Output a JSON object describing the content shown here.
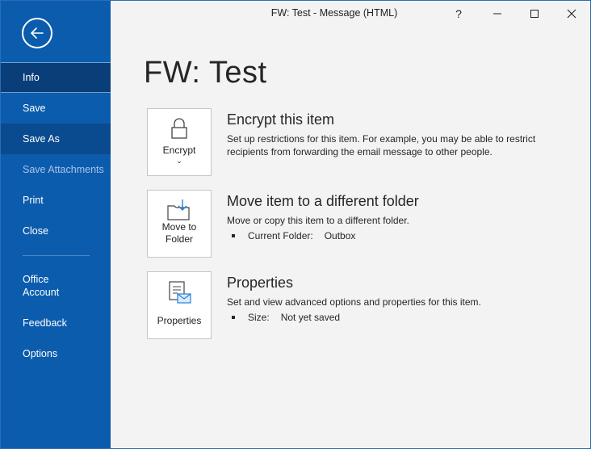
{
  "window": {
    "title": "FW: Test  -  Message (HTML)",
    "help": "?"
  },
  "sidebar": {
    "items": [
      {
        "label": "Info"
      },
      {
        "label": "Save"
      },
      {
        "label": "Save As"
      },
      {
        "label": "Save Attachments"
      },
      {
        "label": "Print"
      },
      {
        "label": "Close"
      },
      {
        "label": "Office\nAccount"
      },
      {
        "label": "Feedback"
      },
      {
        "label": "Options"
      }
    ]
  },
  "main": {
    "title": "FW: Test",
    "sections": [
      {
        "tile_label": "Encrypt",
        "heading": "Encrypt this item",
        "description": "Set up restrictions for this item. For example, you may be able to restrict recipients from forwarding the email message to other people."
      },
      {
        "tile_label": "Move to\nFolder",
        "heading": "Move item to a different folder",
        "description": "Move or copy this item to a different folder.",
        "detail_key": "Current Folder:",
        "detail_value": "Outbox"
      },
      {
        "tile_label": "Properties",
        "heading": "Properties",
        "description": "Set and view advanced options and properties for this item.",
        "detail_key": "Size:",
        "detail_value": "Not yet saved"
      }
    ]
  }
}
